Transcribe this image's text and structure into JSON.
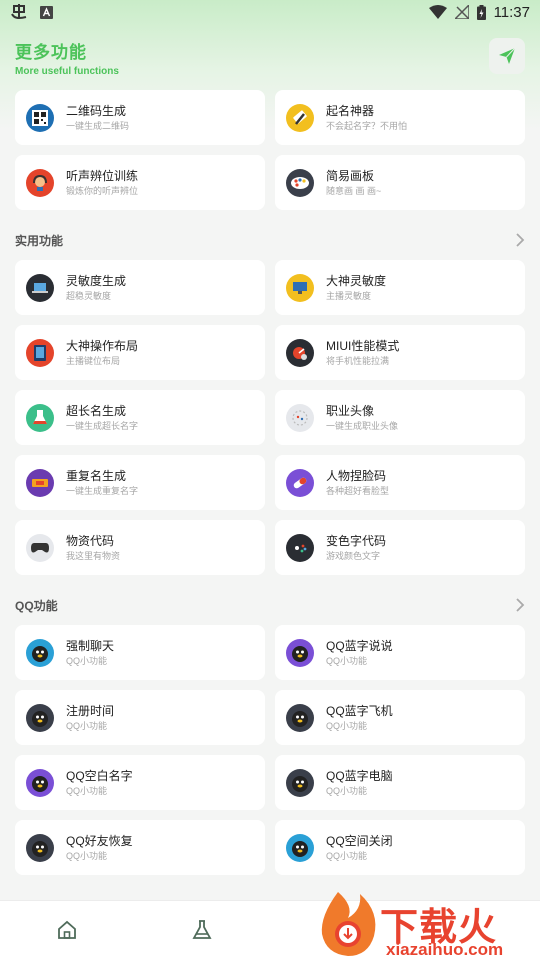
{
  "status_bar": {
    "time": "11:37"
  },
  "header": {
    "title": "更多功能",
    "subtitle": "More useful functions"
  },
  "top_cards": [
    {
      "title": "二维码生成",
      "subtitle": "一键生成二维码",
      "icon": "qr-code-icon"
    },
    {
      "title": "起名神器",
      "subtitle": "不会起名字？不用怕",
      "icon": "pen-icon"
    },
    {
      "title": "听声辨位训练",
      "subtitle": "锻炼你的听声辨位",
      "icon": "headset-icon"
    },
    {
      "title": "简易画板",
      "subtitle": "随意画 画 画~",
      "icon": "palette-icon"
    }
  ],
  "sections": {
    "practical": {
      "title": "实用功能",
      "items": [
        {
          "title": "灵敏度生成",
          "subtitle": "超稳灵敏度",
          "icon": "laptop-icon"
        },
        {
          "title": "大神灵敏度",
          "subtitle": "主播灵敏度",
          "icon": "monitor-icon"
        },
        {
          "title": "大神操作布局",
          "subtitle": "主播键位布局",
          "icon": "tablet-icon"
        },
        {
          "title": "MIUI性能模式",
          "subtitle": "将手机性能拉满",
          "icon": "speedometer-icon"
        },
        {
          "title": "超长名生成",
          "subtitle": "一键生成超长名字",
          "icon": "flask-icon"
        },
        {
          "title": "职业头像",
          "subtitle": "一键生成职业头像",
          "icon": "badge-icon"
        },
        {
          "title": "重复名生成",
          "subtitle": "一键生成重复名字",
          "icon": "ticket-icon"
        },
        {
          "title": "人物捏脸码",
          "subtitle": "各种超好看脸型",
          "icon": "pill-icon"
        },
        {
          "title": "物资代码",
          "subtitle": "我这里有物资",
          "icon": "gamepad-icon"
        },
        {
          "title": "变色字代码",
          "subtitle": "游戏颜色文字",
          "icon": "controller-icon"
        }
      ]
    },
    "qq": {
      "title": "QQ功能",
      "items": [
        {
          "title": "强制聊天",
          "subtitle": "QQ小功能",
          "icon": "qq-penguin-icon"
        },
        {
          "title": "QQ蓝字说说",
          "subtitle": "QQ小功能",
          "icon": "qq-penguin-icon"
        },
        {
          "title": "注册时间",
          "subtitle": "QQ小功能",
          "icon": "qq-penguin-icon"
        },
        {
          "title": "QQ蓝字飞机",
          "subtitle": "QQ小功能",
          "icon": "qq-penguin-icon"
        },
        {
          "title": "QQ空白名字",
          "subtitle": "QQ小功能",
          "icon": "qq-penguin-icon"
        },
        {
          "title": "QQ蓝字电脑",
          "subtitle": "QQ小功能",
          "icon": "qq-penguin-icon"
        },
        {
          "title": "QQ好友恢复",
          "subtitle": "QQ小功能",
          "icon": "qq-penguin-icon"
        },
        {
          "title": "QQ空间关闭",
          "subtitle": "QQ小功能",
          "icon": "qq-penguin-icon"
        }
      ]
    }
  },
  "watermark": {
    "text": "下载火",
    "url": "xiazaihuo.com"
  },
  "colors": {
    "accent": "#4cc35a",
    "watermark": "#e8432f"
  }
}
